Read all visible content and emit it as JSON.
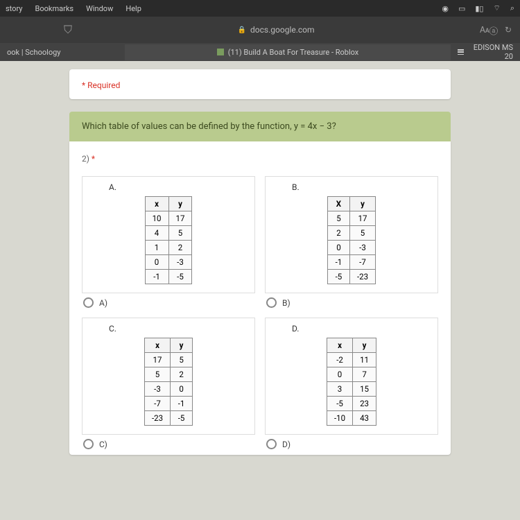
{
  "menubar": {
    "items": [
      "story",
      "Bookmarks",
      "Window",
      "Help"
    ]
  },
  "browser": {
    "url": "docs.google.com"
  },
  "tabs": {
    "left": "ook | Schoology",
    "center": "(11) Build A Boat For Treasure - Roblox",
    "right": "EDISON MS 20"
  },
  "form": {
    "required": "* Required",
    "question_header": "Which table of values can be defined by the function, y = 4x − 3?",
    "qnum": "2) ",
    "asterisk": "*"
  },
  "chart_data": [
    {
      "type": "table",
      "letter": "A.",
      "radio": "A)",
      "headers": [
        "x",
        "y"
      ],
      "rows": [
        [
          "10",
          "17"
        ],
        [
          "4",
          "5"
        ],
        [
          "1",
          "2"
        ],
        [
          "0",
          "-3"
        ],
        [
          "-1",
          "-5"
        ]
      ]
    },
    {
      "type": "table",
      "letter": "B.",
      "radio": "B)",
      "headers": [
        "X",
        "y"
      ],
      "rows": [
        [
          "5",
          "17"
        ],
        [
          "2",
          "5"
        ],
        [
          "0",
          "-3"
        ],
        [
          "-1",
          "-7"
        ],
        [
          "-5",
          "-23"
        ]
      ]
    },
    {
      "type": "table",
      "letter": "C.",
      "radio": "C)",
      "headers": [
        "x",
        "y"
      ],
      "rows": [
        [
          "17",
          "5"
        ],
        [
          "5",
          "2"
        ],
        [
          "-3",
          "0"
        ],
        [
          "-7",
          "-1"
        ],
        [
          "-23",
          "-5"
        ]
      ]
    },
    {
      "type": "table",
      "letter": "D.",
      "radio": "D)",
      "headers": [
        "x",
        "y"
      ],
      "rows": [
        [
          "-2",
          "11"
        ],
        [
          "0",
          "7"
        ],
        [
          "3",
          "15"
        ],
        [
          "-5",
          "23"
        ],
        [
          "-10",
          "43"
        ]
      ]
    }
  ]
}
